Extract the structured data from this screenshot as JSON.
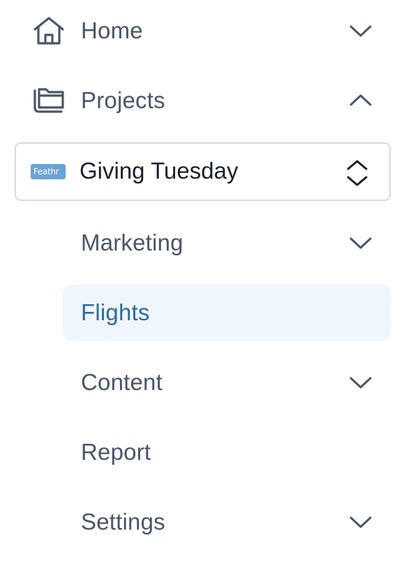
{
  "nav": {
    "home": {
      "label": "Home",
      "icon": "home-icon",
      "expanded": false
    },
    "projects": {
      "label": "Projects",
      "icon": "folders-icon",
      "expanded": true
    },
    "project_selector": {
      "logo_text": "Feathr",
      "name": "Giving Tuesday"
    },
    "sub_items": [
      {
        "label": "Marketing",
        "has_children": true,
        "active": false
      },
      {
        "label": "Flights",
        "has_children": false,
        "active": true
      },
      {
        "label": "Content",
        "has_children": true,
        "active": false
      },
      {
        "label": "Report",
        "has_children": false,
        "active": false
      },
      {
        "label": "Settings",
        "has_children": true,
        "active": false
      }
    ]
  },
  "colors": {
    "text": "#4a5568",
    "active_text": "#2f6aa0",
    "active_bg": "#eff6fd",
    "border": "#d5dbe3",
    "logo_bg": "#6aa3d8"
  }
}
